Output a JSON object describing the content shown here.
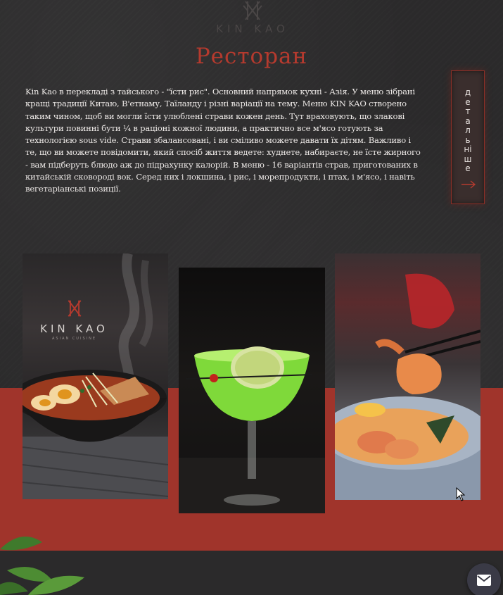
{
  "brand": {
    "name": "KIN KAO",
    "tagline": "ASIAN CUISINE"
  },
  "section": {
    "title": "Ресторан",
    "description": "Kin Kao в перекладі з тайського - \"їсти рис\". Основний напрямок кухні - Азія. У меню зібрані кращі традиції Китаю, В'етнаму, Таїланду і різні варіації на тему. Меню KIN KAO створено таким чином, щоб ви могли їсти улюблені страви кожен день. Тут враховують, що злакові культури повинні бути ¼ в раціоні кожної людини, а практично все м'ясо готують за технологією sous vide. Страви збалансовані, і ви сміливо можете давати їх дітям. Важливо і те, що ви можете повідомити, який спосіб життя ведете: худнете, набираєте, не їсте жирного - вам підберуть блюдо аж до підрахунку калорій. В меню - 16 варіантів страв, приготованих в китайській сковороді вок. Серед них і локшина, і рис, і морепродукти, і птах, і м'ясо, і навіть вегетаріанські позиції.",
    "more_label": "детальніше"
  },
  "gallery": {
    "card1_logo": "KIN KAO",
    "card1_logo_sub": "ASIAN CUISINE"
  },
  "icons": {
    "logo": "kinkao-logo-icon",
    "more_arrow": "arrow-right-icon",
    "mail": "mail-icon",
    "cursor": "mouse-pointer-icon",
    "leaves": "decorative-leaves-icon"
  },
  "colors": {
    "background": "#2b2a2b",
    "accent_red": "#b53a2e",
    "band_red": "#a0342b",
    "text": "#ece8e6",
    "mail_button": "#3a3a46"
  }
}
